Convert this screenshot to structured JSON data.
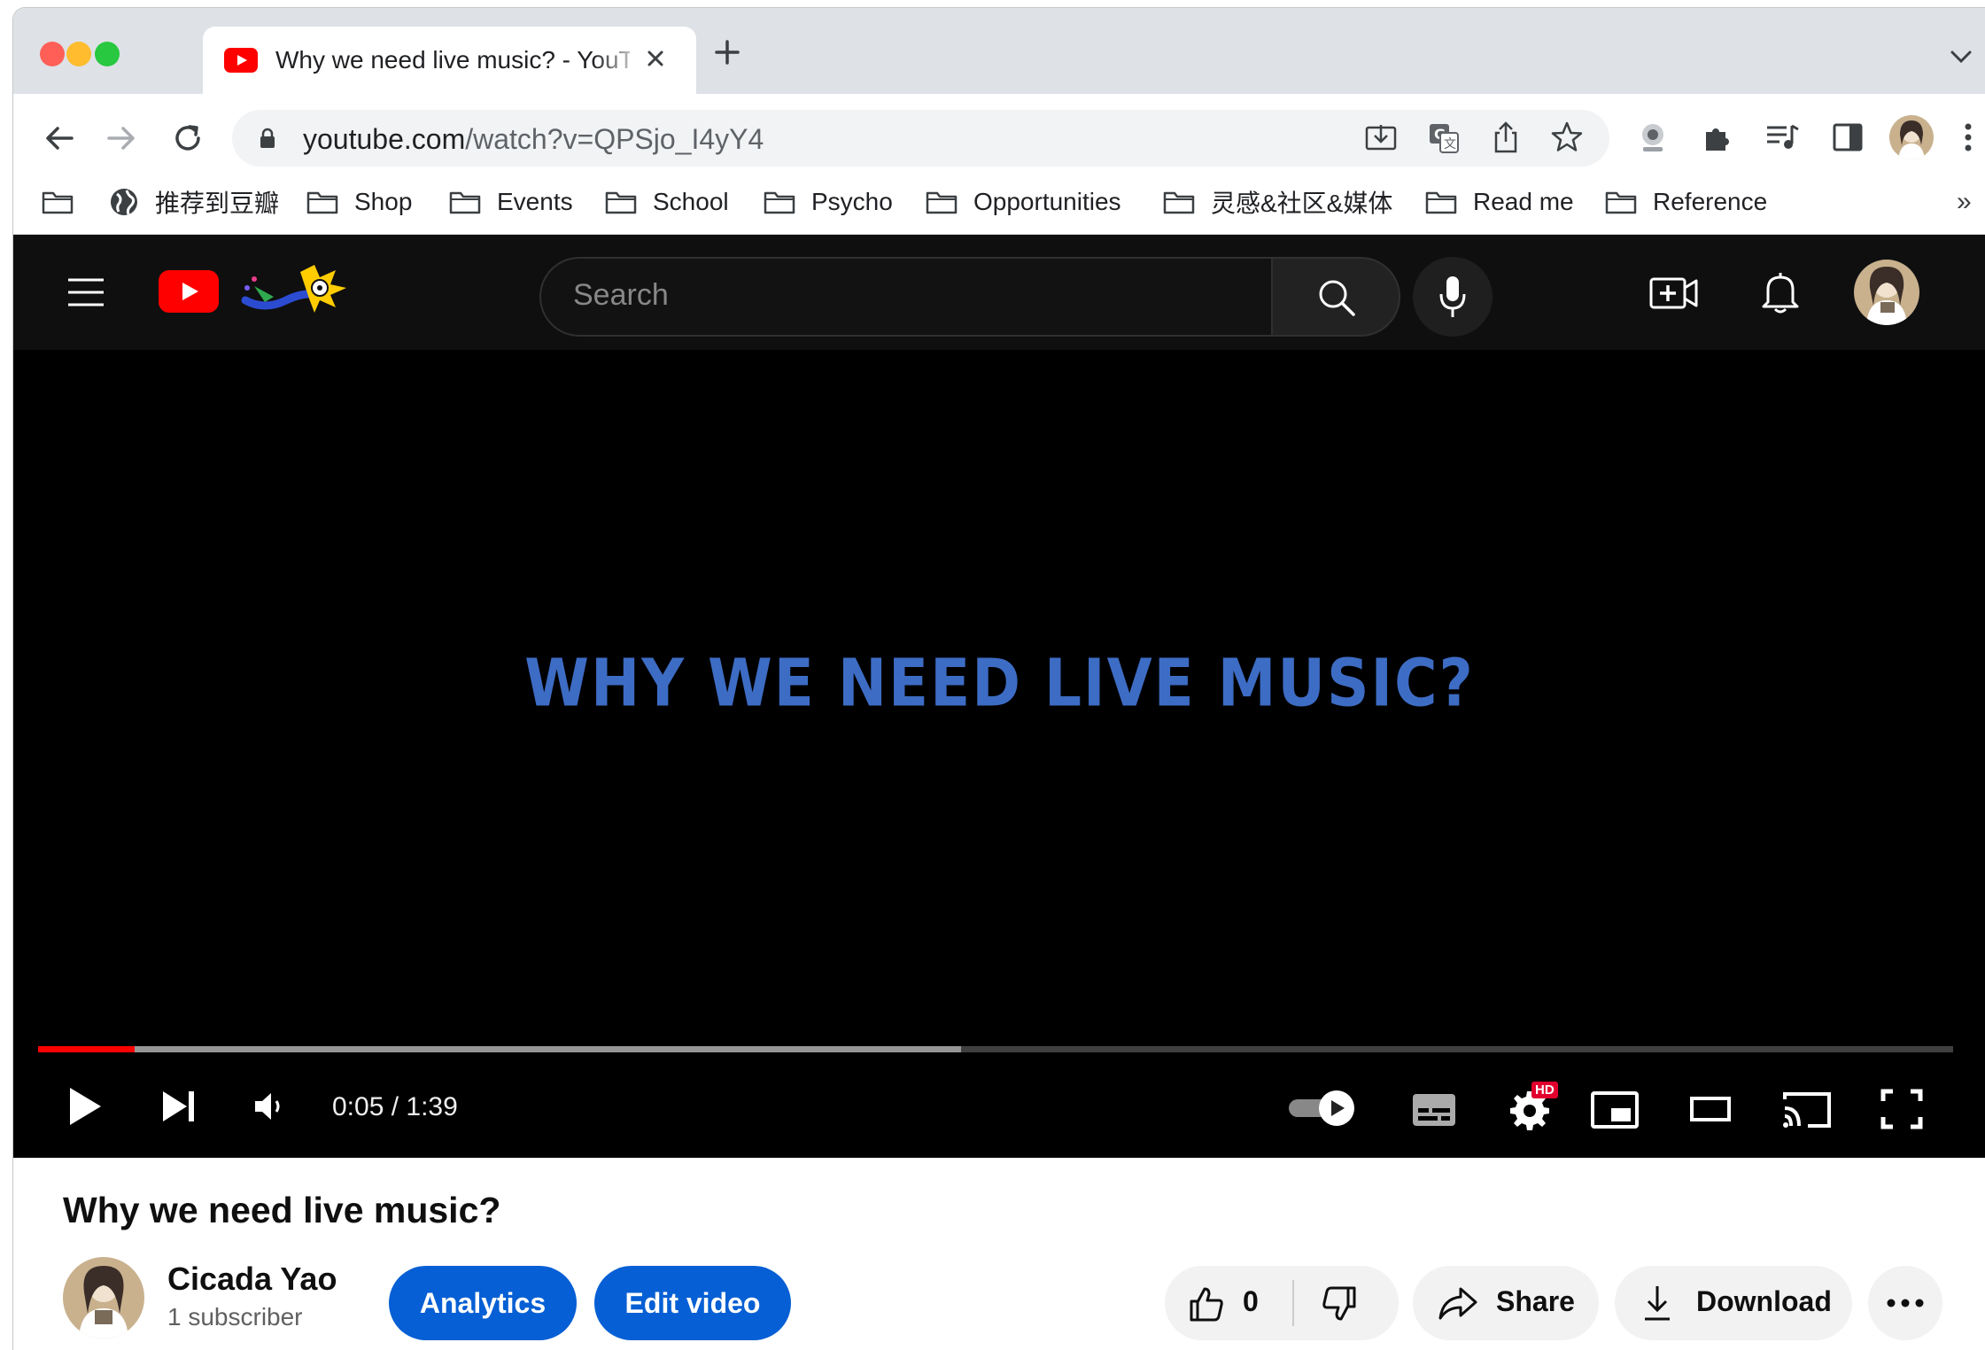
{
  "browser": {
    "tab_title": "Why we need live music? - YouTube",
    "url_host": "youtube.com",
    "url_path": "/watch?v=QPSjo_I4yY4",
    "bookmarks": [
      {
        "label": "",
        "icon": "folder-icon"
      },
      {
        "label": "推荐到豆瓣",
        "icon": "globe-icon"
      },
      {
        "label": "Shop",
        "icon": "folder-icon"
      },
      {
        "label": "Events",
        "icon": "folder-icon"
      },
      {
        "label": "School",
        "icon": "folder-icon"
      },
      {
        "label": "Psycho",
        "icon": "folder-icon"
      },
      {
        "label": "Opportunities",
        "icon": "folder-icon"
      },
      {
        "label": "灵感&社区&媒体",
        "icon": "folder-icon"
      },
      {
        "label": "Read me",
        "icon": "folder-icon"
      },
      {
        "label": "Reference",
        "icon": "folder-icon"
      }
    ],
    "more_bookmarks": "»"
  },
  "youtube": {
    "search_placeholder": "Search",
    "video_overlay_text": "WHY WE NEED LIVE MUSIC?",
    "player": {
      "time": "0:05 / 1:39",
      "played_fraction": 0.0505,
      "buffered_fraction": 0.4818,
      "hd_badge": "HD"
    },
    "watch": {
      "title": "Why we need live music?",
      "channel_name": "Cicada Yao",
      "subscribers": "1 subscriber",
      "analytics_label": "Analytics",
      "edit_label": "Edit video",
      "like_count": "0",
      "share_label": "Share",
      "download_label": "Download"
    }
  },
  "colors": {
    "youtube_red": "#ff0000",
    "overlay_text": "#3d6cc4",
    "primary_button": "#065fd4"
  }
}
